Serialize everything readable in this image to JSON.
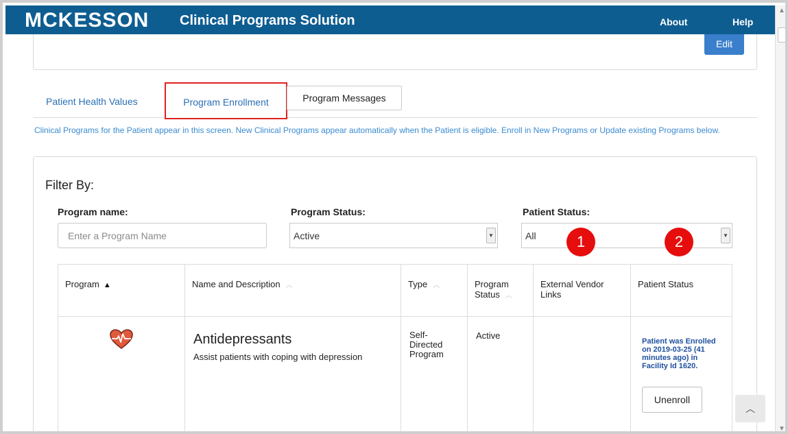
{
  "header": {
    "brand": "MCKESSON",
    "app_title": "Clinical Programs Solution",
    "nav": {
      "about": "About",
      "help": "Help"
    },
    "background_color": "#0e5d91"
  },
  "top_card": {
    "edit_label": "Edit"
  },
  "tabs": {
    "health_values": "Patient Health Values",
    "program_enrollment": "Program Enrollment",
    "program_messages": "Program Messages"
  },
  "intro_text": "Clinical Programs for the Patient appear in this screen. New Clinical Programs appear automatically when the Patient is eligible. Enroll in New Programs or Update existing Programs below.",
  "filter": {
    "heading": "Filter By:",
    "program_name_label": "Program name:",
    "program_name_placeholder": "Enter a Program Name",
    "program_status_label": "Program Status:",
    "program_status_value": "Active",
    "patient_status_label": "Patient Status:",
    "patient_status_value": "All"
  },
  "annotations": {
    "badge_1": "1",
    "badge_2": "2",
    "color": "#e60d0d"
  },
  "table": {
    "headers": {
      "program": "Program",
      "name_description": "Name and Description",
      "type": "Type",
      "program_status": "Program Status",
      "vendor_links": "External Vendor Links",
      "patient_status": "Patient Status"
    },
    "rows": [
      {
        "icon": "heart-pulse-icon",
        "name": "Antidepressants",
        "description": "Assist patients with coping with depression",
        "type": "Self-Directed Program",
        "program_status": "Active",
        "vendor_links": "",
        "patient_status": "Patient was Enrolled on 2019-03-25 (41 minutes ago) in Facility Id 1620.",
        "action_label": "Unenroll"
      }
    ]
  },
  "scroll_top_icon": "chevron-up-icon"
}
